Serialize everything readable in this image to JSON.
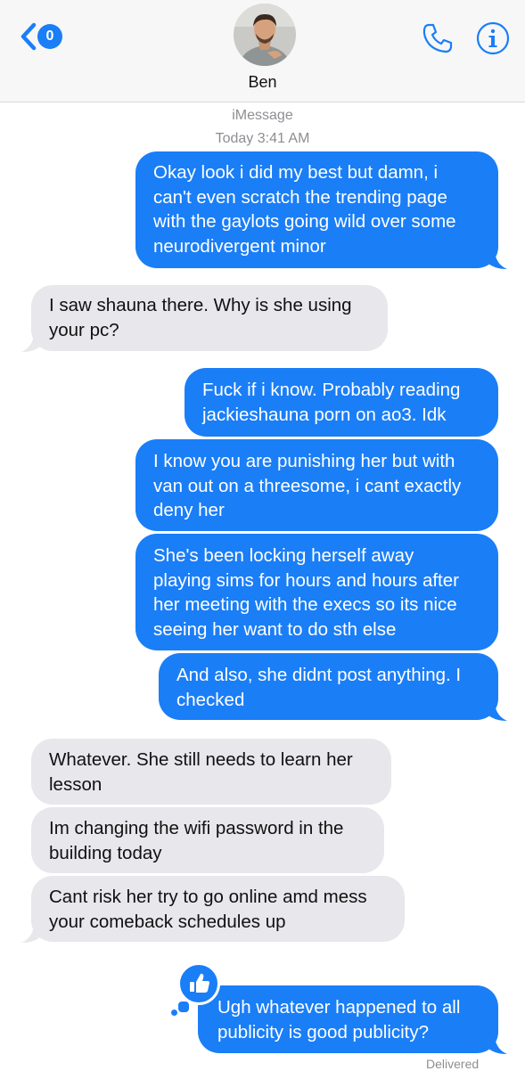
{
  "header": {
    "back_badge": "0",
    "contact_name": "Ben",
    "back_icon": "chevron-left-icon",
    "call_icon": "phone-icon",
    "info_icon": "info-icon"
  },
  "thread": {
    "service": "iMessage",
    "timestamp": "Today 3:41 AM"
  },
  "messages": [
    {
      "from": "me",
      "text": "Okay look i did my best but damn, i\ncan't even scratch the trending page\nwith the gaylots going wild over some\nneurodivergent minor"
    },
    {
      "from": "them",
      "text": "I saw shauna there. Why is she using\nyour pc?"
    },
    {
      "from": "me",
      "text": "Fuck if i know.  Probably reading\njackieshauna porn on ao3. Idk"
    },
    {
      "from": "me",
      "text": "I know you are punishing her but with\nvan out on a threesome, i cant exactly\ndeny her"
    },
    {
      "from": "me",
      "text": "She's been locking herself away\nplaying sims for hours and hours after\nher meeting with the execs so its nice\nseeing her want to do sth else"
    },
    {
      "from": "me",
      "text": "And also, she didnt post anything. I\nchecked"
    },
    {
      "from": "them",
      "text": "Whatever. She still needs to learn her\nlesson"
    },
    {
      "from": "them",
      "text": "Im changing the wifi password in the\nbuilding today"
    },
    {
      "from": "them",
      "text": "Cant risk her try to go online amd mess\nyour comeback schedules up"
    },
    {
      "from": "me",
      "text": "Ugh whatever happened to all\npublicity is good publicity?",
      "tapback": "thumbs-up-icon"
    }
  ],
  "status": "Delivered",
  "colors": {
    "sent": "#1a7ef7",
    "received": "#e7e7ec",
    "meta": "#8e8e93"
  }
}
